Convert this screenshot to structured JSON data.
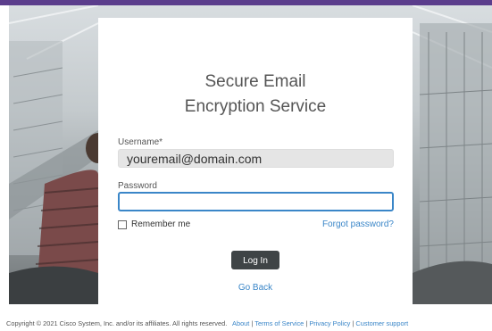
{
  "app": {
    "title_line1": "Secure Email",
    "title_line2": "Encryption Service"
  },
  "form": {
    "username_label": "Username*",
    "username_value": "youremail@domain.com",
    "password_label": "Password",
    "password_value": "",
    "remember_label": "Remember me",
    "remember_checked": false,
    "forgot_label": "Forgot password?",
    "login_label": "Log In",
    "go_back_label": "Go Back"
  },
  "footer": {
    "copyright": "Copyright © 2021 Cisco System, Inc. and/or its affiliates. All rights reserved.",
    "links": [
      "About",
      "Terms of Service",
      "Privacy Policy",
      "Customer support"
    ],
    "separator": "|"
  },
  "colors": {
    "accent": "#3a86c8",
    "top_bar": "#5b3d8c",
    "button": "#3f4446"
  }
}
